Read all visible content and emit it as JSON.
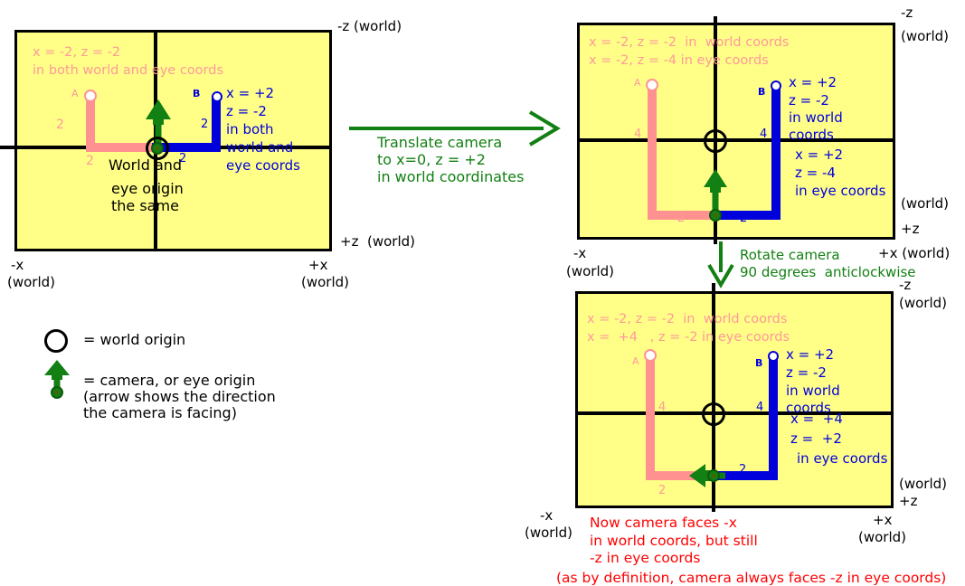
{
  "colors": {
    "panel_bg": "#ffff88",
    "panel_border": "#000000",
    "pink": "#ff9999",
    "blue": "#0000dd",
    "green": "#128012",
    "red": "#ff0000",
    "black": "#000000"
  },
  "legend": {
    "world_origin_label": "= world origin",
    "camera_label_line1": "= camera, or eye origin",
    "camera_label_line2": "(arrow shows the direction",
    "camera_label_line3": "the camera is facing)"
  },
  "panel1": {
    "name": "initial-camera-at-world-origin",
    "pink_note_line1": "x = -2, z = -2",
    "pink_note_line2": "in both world and eye coords",
    "label_A": "A",
    "label_B": "B",
    "pink_len_vertical": "2",
    "pink_len_horizontal": "2",
    "blue_len_vertical": "2",
    "blue_len_horizontal": "2",
    "blue_note_line1": "x = +2",
    "blue_note_line2": "z = -2",
    "blue_note_line3": "in both",
    "blue_note_line4": "world and",
    "blue_note_line5": "eye coords",
    "origin_note_line1": "World and",
    "origin_note_line2": "eye origin",
    "origin_note_line3": "the same",
    "axis_minus_z": "-z (world)",
    "axis_plus_z": "+z  (world)",
    "axis_minus_x_line1": "-x",
    "axis_minus_x_line2": "(world)",
    "axis_plus_x_line1": "+x",
    "axis_plus_x_line2": "(world)"
  },
  "arrow_translate": {
    "line1": "Translate camera",
    "line2": "to x=0, z = +2",
    "line3": "in world coordinates"
  },
  "arrow_rotate": {
    "line1": "Rotate camera",
    "line2": "90 degrees  anticlockwise"
  },
  "panel2": {
    "name": "camera-translated",
    "pink_note_line1": "x = -2, z = -2  in  world coords",
    "pink_note_line2": "x = -2, z = -4 in eye coords",
    "label_A": "A",
    "label_B": "B",
    "pink_len_vertical": "4",
    "pink_len_horizontal": "2",
    "blue_len_vertical": "4",
    "blue_len_horizontal": "2",
    "blue_note_line1": "x = +2",
    "blue_note_line2": "z = -2",
    "blue_note_line3": "in world",
    "blue_note_line4": "coords",
    "blue_note2_line1": "x = +2",
    "blue_note2_line2": "z = -4",
    "blue_note2_line3": "in eye coords",
    "axis_minus_z_line1": "-z",
    "axis_minus_z_line2": "(world)",
    "axis_plus_z_line1": "(world)",
    "axis_plus_z_line2": "+z",
    "axis_minus_x_line1": "-x",
    "axis_minus_x_line2": "(world)",
    "axis_plus_x": "+x (world)"
  },
  "panel3": {
    "name": "camera-rotated",
    "pink_note_line1": "x = -2, z = -2  in  world coords",
    "pink_note_line2": "x =  +4   , z = -2 in eye coords",
    "label_A": "A",
    "label_B": "B",
    "pink_len_vertical": "4",
    "pink_len_horizontal": "2",
    "blue_len_vertical": "4",
    "blue_len_horizontal": "2",
    "blue_note_line1": "x = +2",
    "blue_note_line2": "z = -2",
    "blue_note_line3": "in world",
    "blue_note_line4": "coords",
    "blue_note2_line1": "x =  +4",
    "blue_note2_line2": "z =  +2",
    "blue_note2_line3": "in eye coords",
    "axis_minus_z_line1": "-z",
    "axis_minus_z_line2": "(world)",
    "axis_plus_z_line1": "(world)",
    "axis_plus_z_line2": "+z",
    "axis_minus_x_line1": "-x",
    "axis_minus_x_line2": "(world)",
    "axis_plus_x_line1": "+x",
    "axis_plus_x_line2": "(world)",
    "red_note_line1": "Now camera faces -x",
    "red_note_line2": "in world coords, but still",
    "red_note_line3": "-z in eye coords",
    "red_note_line4": "(as by definition, camera always faces -z in eye coords)"
  }
}
